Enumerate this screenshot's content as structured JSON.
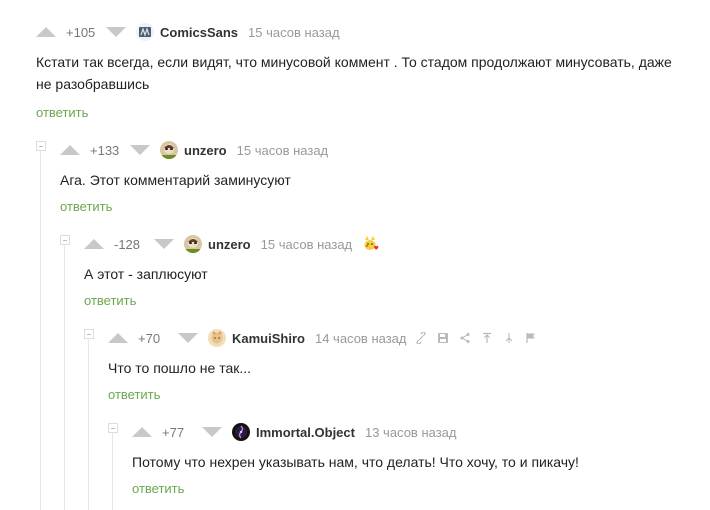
{
  "comments": [
    {
      "rating": "+105",
      "username": "ComicsSans",
      "time": "15 часов назад",
      "text_line1": "Кстати так всегда, если видят, что минусовой коммент . То стадом продолжают минусовать, даже",
      "text_line2": "не разобравшись",
      "reply": "ответить"
    },
    {
      "rating": "+133",
      "username": "unzero",
      "time": "15 часов назад",
      "text": "Ага. Этот комментарий заминусуют",
      "reply": "ответить"
    },
    {
      "rating": "-128",
      "username": "unzero",
      "time": "15 часов назад",
      "text": "А этот - заплюсуют",
      "reply": "ответить"
    },
    {
      "rating": "+70",
      "username": "KamuiShiro",
      "time": "14 часов назад",
      "text": "Что то пошло не так...",
      "reply": "ответить"
    },
    {
      "rating": "+77",
      "username": "Immortal.Object",
      "time": "13 часов назад",
      "text": "Потому что нехрен указывать нам, что делать! Что хочу, то и пикачу!",
      "reply": "ответить"
    }
  ],
  "colors": {
    "reply_link": "#6aa84f",
    "muted": "#999999",
    "vote_arrow": "#c8c8c8",
    "thread_line": "#e8e8e8"
  },
  "icons": {
    "badge": "pikachu-heart-icon",
    "actions": [
      "link-icon",
      "save-icon",
      "share-icon",
      "scroll-up-icon",
      "branch-icon",
      "flag-icon"
    ]
  }
}
